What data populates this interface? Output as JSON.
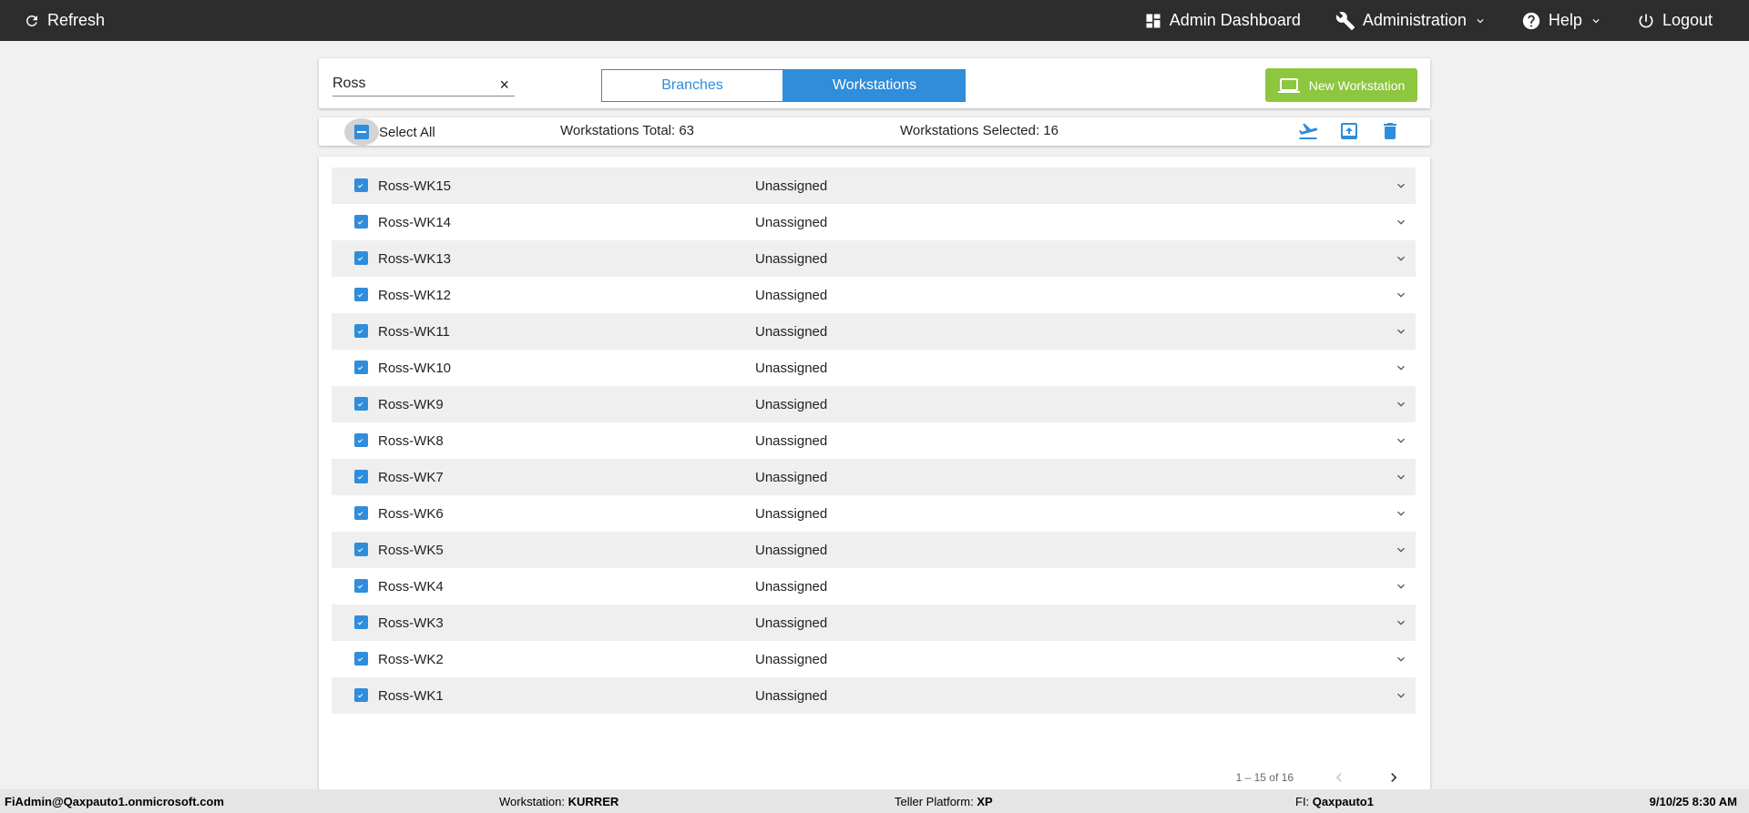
{
  "topbar": {
    "refresh_label": "Refresh",
    "admin_dashboard_label": "Admin Dashboard",
    "administration_label": "Administration",
    "help_label": "Help",
    "logout_label": "Logout"
  },
  "toolbar": {
    "search_value": "Ross",
    "clear_symbol": "×",
    "branches_label": "Branches",
    "workstations_label": "Workstations",
    "new_workstation_label": "New Workstation"
  },
  "selection": {
    "select_all_label": "Select All",
    "total_text": "Workstations Total: 63",
    "selected_text": "Workstations Selected: 16"
  },
  "rows": [
    {
      "name": "Ross-WK15",
      "status": "Unassigned"
    },
    {
      "name": "Ross-WK14",
      "status": "Unassigned"
    },
    {
      "name": "Ross-WK13",
      "status": "Unassigned"
    },
    {
      "name": "Ross-WK12",
      "status": "Unassigned"
    },
    {
      "name": "Ross-WK11",
      "status": "Unassigned"
    },
    {
      "name": "Ross-WK10",
      "status": "Unassigned"
    },
    {
      "name": "Ross-WK9",
      "status": "Unassigned"
    },
    {
      "name": "Ross-WK8",
      "status": "Unassigned"
    },
    {
      "name": "Ross-WK7",
      "status": "Unassigned"
    },
    {
      "name": "Ross-WK6",
      "status": "Unassigned"
    },
    {
      "name": "Ross-WK5",
      "status": "Unassigned"
    },
    {
      "name": "Ross-WK4",
      "status": "Unassigned"
    },
    {
      "name": "Ross-WK3",
      "status": "Unassigned"
    },
    {
      "name": "Ross-WK2",
      "status": "Unassigned"
    },
    {
      "name": "Ross-WK1",
      "status": "Unassigned"
    }
  ],
  "pager": {
    "range_text": "1 – 15 of 16"
  },
  "statusbar": {
    "user": "FiAdmin@Qaxpauto1.onmicrosoft.com",
    "workstation_label": "Workstation:",
    "workstation_value": "KURRER",
    "teller_label": "Teller Platform:",
    "teller_value": "XP",
    "fi_label": "FI:",
    "fi_value": "Qaxpauto1",
    "datetime": "9/10/25 8:30 AM"
  },
  "colors": {
    "accent": "#2f8ddb",
    "success": "#8dc63f",
    "topbar": "#2d2d2d"
  }
}
